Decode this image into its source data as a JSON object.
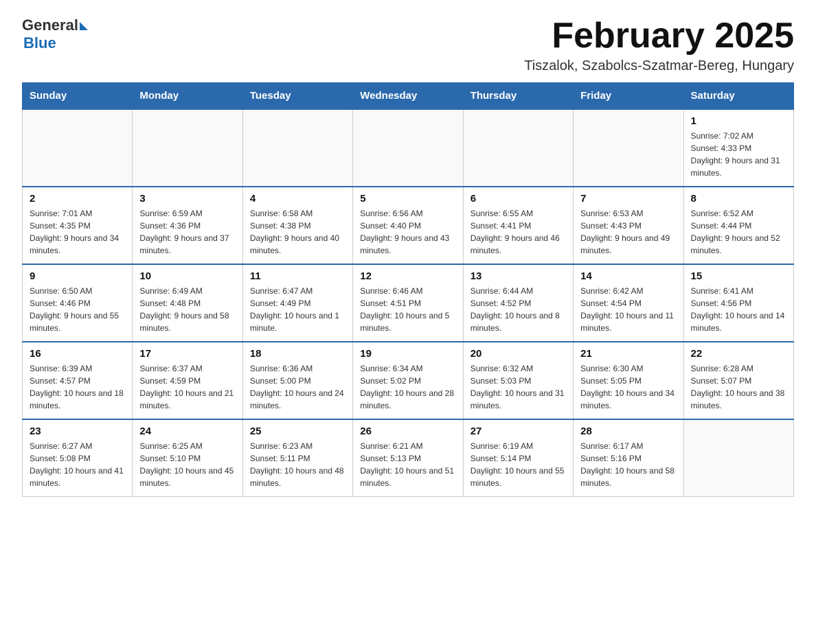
{
  "header": {
    "logo_general": "General",
    "logo_blue": "Blue",
    "month_title": "February 2025",
    "location": "Tiszalok, Szabolcs-Szatmar-Bereg, Hungary"
  },
  "weekdays": [
    "Sunday",
    "Monday",
    "Tuesday",
    "Wednesday",
    "Thursday",
    "Friday",
    "Saturday"
  ],
  "weeks": [
    [
      {
        "day": "",
        "info": ""
      },
      {
        "day": "",
        "info": ""
      },
      {
        "day": "",
        "info": ""
      },
      {
        "day": "",
        "info": ""
      },
      {
        "day": "",
        "info": ""
      },
      {
        "day": "",
        "info": ""
      },
      {
        "day": "1",
        "info": "Sunrise: 7:02 AM\nSunset: 4:33 PM\nDaylight: 9 hours and 31 minutes."
      }
    ],
    [
      {
        "day": "2",
        "info": "Sunrise: 7:01 AM\nSunset: 4:35 PM\nDaylight: 9 hours and 34 minutes."
      },
      {
        "day": "3",
        "info": "Sunrise: 6:59 AM\nSunset: 4:36 PM\nDaylight: 9 hours and 37 minutes."
      },
      {
        "day": "4",
        "info": "Sunrise: 6:58 AM\nSunset: 4:38 PM\nDaylight: 9 hours and 40 minutes."
      },
      {
        "day": "5",
        "info": "Sunrise: 6:56 AM\nSunset: 4:40 PM\nDaylight: 9 hours and 43 minutes."
      },
      {
        "day": "6",
        "info": "Sunrise: 6:55 AM\nSunset: 4:41 PM\nDaylight: 9 hours and 46 minutes."
      },
      {
        "day": "7",
        "info": "Sunrise: 6:53 AM\nSunset: 4:43 PM\nDaylight: 9 hours and 49 minutes."
      },
      {
        "day": "8",
        "info": "Sunrise: 6:52 AM\nSunset: 4:44 PM\nDaylight: 9 hours and 52 minutes."
      }
    ],
    [
      {
        "day": "9",
        "info": "Sunrise: 6:50 AM\nSunset: 4:46 PM\nDaylight: 9 hours and 55 minutes."
      },
      {
        "day": "10",
        "info": "Sunrise: 6:49 AM\nSunset: 4:48 PM\nDaylight: 9 hours and 58 minutes."
      },
      {
        "day": "11",
        "info": "Sunrise: 6:47 AM\nSunset: 4:49 PM\nDaylight: 10 hours and 1 minute."
      },
      {
        "day": "12",
        "info": "Sunrise: 6:46 AM\nSunset: 4:51 PM\nDaylight: 10 hours and 5 minutes."
      },
      {
        "day": "13",
        "info": "Sunrise: 6:44 AM\nSunset: 4:52 PM\nDaylight: 10 hours and 8 minutes."
      },
      {
        "day": "14",
        "info": "Sunrise: 6:42 AM\nSunset: 4:54 PM\nDaylight: 10 hours and 11 minutes."
      },
      {
        "day": "15",
        "info": "Sunrise: 6:41 AM\nSunset: 4:56 PM\nDaylight: 10 hours and 14 minutes."
      }
    ],
    [
      {
        "day": "16",
        "info": "Sunrise: 6:39 AM\nSunset: 4:57 PM\nDaylight: 10 hours and 18 minutes."
      },
      {
        "day": "17",
        "info": "Sunrise: 6:37 AM\nSunset: 4:59 PM\nDaylight: 10 hours and 21 minutes."
      },
      {
        "day": "18",
        "info": "Sunrise: 6:36 AM\nSunset: 5:00 PM\nDaylight: 10 hours and 24 minutes."
      },
      {
        "day": "19",
        "info": "Sunrise: 6:34 AM\nSunset: 5:02 PM\nDaylight: 10 hours and 28 minutes."
      },
      {
        "day": "20",
        "info": "Sunrise: 6:32 AM\nSunset: 5:03 PM\nDaylight: 10 hours and 31 minutes."
      },
      {
        "day": "21",
        "info": "Sunrise: 6:30 AM\nSunset: 5:05 PM\nDaylight: 10 hours and 34 minutes."
      },
      {
        "day": "22",
        "info": "Sunrise: 6:28 AM\nSunset: 5:07 PM\nDaylight: 10 hours and 38 minutes."
      }
    ],
    [
      {
        "day": "23",
        "info": "Sunrise: 6:27 AM\nSunset: 5:08 PM\nDaylight: 10 hours and 41 minutes."
      },
      {
        "day": "24",
        "info": "Sunrise: 6:25 AM\nSunset: 5:10 PM\nDaylight: 10 hours and 45 minutes."
      },
      {
        "day": "25",
        "info": "Sunrise: 6:23 AM\nSunset: 5:11 PM\nDaylight: 10 hours and 48 minutes."
      },
      {
        "day": "26",
        "info": "Sunrise: 6:21 AM\nSunset: 5:13 PM\nDaylight: 10 hours and 51 minutes."
      },
      {
        "day": "27",
        "info": "Sunrise: 6:19 AM\nSunset: 5:14 PM\nDaylight: 10 hours and 55 minutes."
      },
      {
        "day": "28",
        "info": "Sunrise: 6:17 AM\nSunset: 5:16 PM\nDaylight: 10 hours and 58 minutes."
      },
      {
        "day": "",
        "info": ""
      }
    ]
  ]
}
